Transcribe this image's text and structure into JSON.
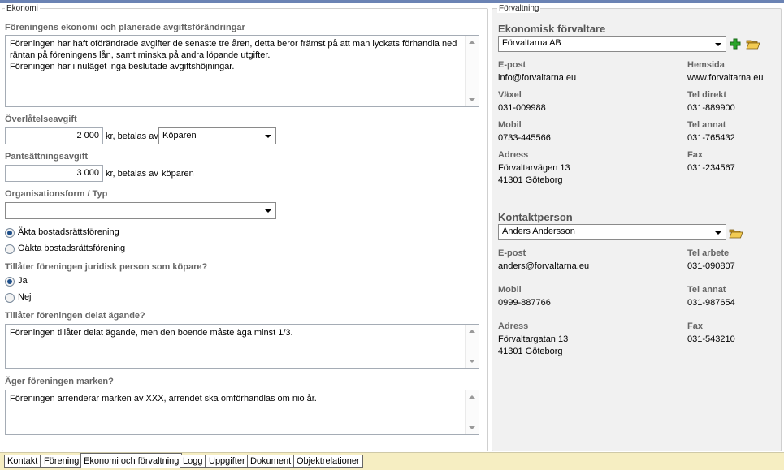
{
  "ekonomi": {
    "legend": "Ekonomi",
    "planned_fee_changes": {
      "label": "Föreningens ekonomi och planerade avgiftsförändringar",
      "lines": [
        "Föreningen har haft oförändrade avgifter de senaste tre åren, detta beror främst på att man lyckats förhandla ned",
        "räntan på föreningens lån, samt minska på andra löpande utgifter.",
        "Föreningen har i nuläget inga beslutade avgiftshöjningar."
      ]
    },
    "transfer_fee": {
      "label": "Överlåtelseavgift",
      "value": "2 000",
      "suffix": "kr, betalas av",
      "payer": "Köparen"
    },
    "pledge_fee": {
      "label": "Pantsättningsavgift",
      "value": "3 000",
      "suffix": "kr, betalas av",
      "payer": "köparen"
    },
    "org_form": {
      "label": "Organisationsform / Typ",
      "value": "",
      "options": [
        {
          "label": "Äkta bostadsrättsförening",
          "checked": true
        },
        {
          "label": "Oäkta bostadsrättsförening",
          "checked": false
        }
      ]
    },
    "legal_person": {
      "label": "Tillåter föreningen juridisk person som köpare?",
      "options": [
        {
          "label": "Ja",
          "checked": true
        },
        {
          "label": "Nej",
          "checked": false
        }
      ]
    },
    "shared_ownership": {
      "label": "Tillåter föreningen delat ägande?",
      "text": "Föreningen tillåter delat ägande, men den boende måste äga minst 1/3."
    },
    "land_ownership": {
      "label": "Äger föreningen marken?",
      "text": "Föreningen arrenderar marken av XXX, arrendet ska omförhandlas om nio år."
    }
  },
  "forvaltning": {
    "legend": "Förvaltning",
    "manager": {
      "title": "Ekonomisk förvaltare",
      "selected": "Förvaltarna AB",
      "fields": {
        "email_label": "E-post",
        "email": "info@forvaltarna.eu",
        "website_label": "Hemsida",
        "website": "www.forvaltarna.eu",
        "switchboard_label": "Växel",
        "switchboard": "031-009988",
        "direct_label": "Tel direkt",
        "direct": "031-889900",
        "mobile_label": "Mobil",
        "mobile": "0733-445566",
        "other_label": "Tel annat",
        "other": "031-765432",
        "address_label": "Adress",
        "address_1": "Förvaltarvägen 13",
        "address_2": "41301 Göteborg",
        "fax_label": "Fax",
        "fax": "031-234567"
      }
    },
    "contact": {
      "title": "Kontaktperson",
      "selected": "Anders Andersson",
      "fields": {
        "email_label": "E-post",
        "email": "anders@forvaltarna.eu",
        "work_label": "Tel arbete",
        "work": "031-090807",
        "mobile_label": "Mobil",
        "mobile": "0999-887766",
        "other_label": "Tel annat",
        "other": "031-987654",
        "address_label": "Adress",
        "address_1": "Förvaltargatan 13",
        "address_2": "41301 Göteborg",
        "fax_label": "Fax",
        "fax": "031-543210"
      }
    }
  },
  "tabs": [
    {
      "label": "Kontakt",
      "active": false
    },
    {
      "label": "Förening",
      "active": false
    },
    {
      "label": "Ekonomi och förvaltning",
      "active": true
    },
    {
      "label": "Logg",
      "active": false
    },
    {
      "label": "Uppgifter",
      "active": false
    },
    {
      "label": "Dokument",
      "active": false
    },
    {
      "label": "Objektrelationer",
      "active": false
    }
  ],
  "colors": {
    "accent_bar": "#6b83b4",
    "tabbar_bg": "#f6eec2",
    "label_gray": "#666666",
    "radio_dot": "#1d4f8b",
    "add_icon": "#2aa52a",
    "folder_icon": "#e6b93a"
  },
  "icons": {
    "add": "plus-icon",
    "open": "folder-open-icon"
  }
}
